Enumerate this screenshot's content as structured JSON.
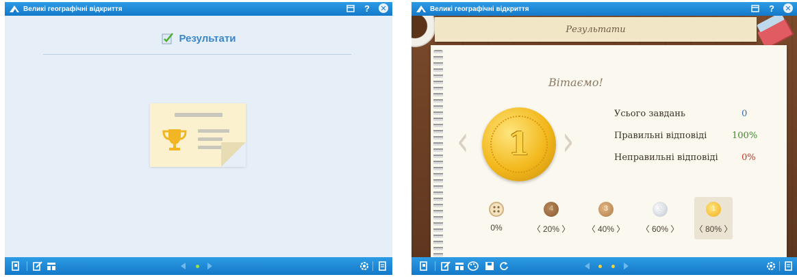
{
  "app_title": "Великі географічні відкриття",
  "left_window": {
    "results_title": "Результати"
  },
  "right_window": {
    "header_title": "Результати",
    "greeting": "Вітаємо!",
    "big_medal_number": "1",
    "stats": [
      {
        "label": "Усього завдань",
        "value": "0",
        "color": "#3b6aa8"
      },
      {
        "label": "Правильні відповіді",
        "value": "100%",
        "color": "#3c8a2e"
      },
      {
        "label": "Неправильні відповіді",
        "value": "0%",
        "color": "#c0392b"
      }
    ],
    "medals": [
      {
        "label": "0%",
        "number": "",
        "kind": "button"
      },
      {
        "label": "〈 20% 〉",
        "number": "4",
        "kind": "bronze-bitten"
      },
      {
        "label": "〈 40% 〉",
        "number": "3",
        "kind": "bronze"
      },
      {
        "label": "〈 60% 〉",
        "number": "2",
        "kind": "silver"
      },
      {
        "label": "〈 80% 〉",
        "number": "1",
        "kind": "gold"
      }
    ]
  },
  "colors": {
    "bar": "#1a86d6",
    "title_blue": "#3a86c8",
    "nav_dot_active": "#9be24a",
    "nav_dot_yellow": "#f4d23a"
  }
}
